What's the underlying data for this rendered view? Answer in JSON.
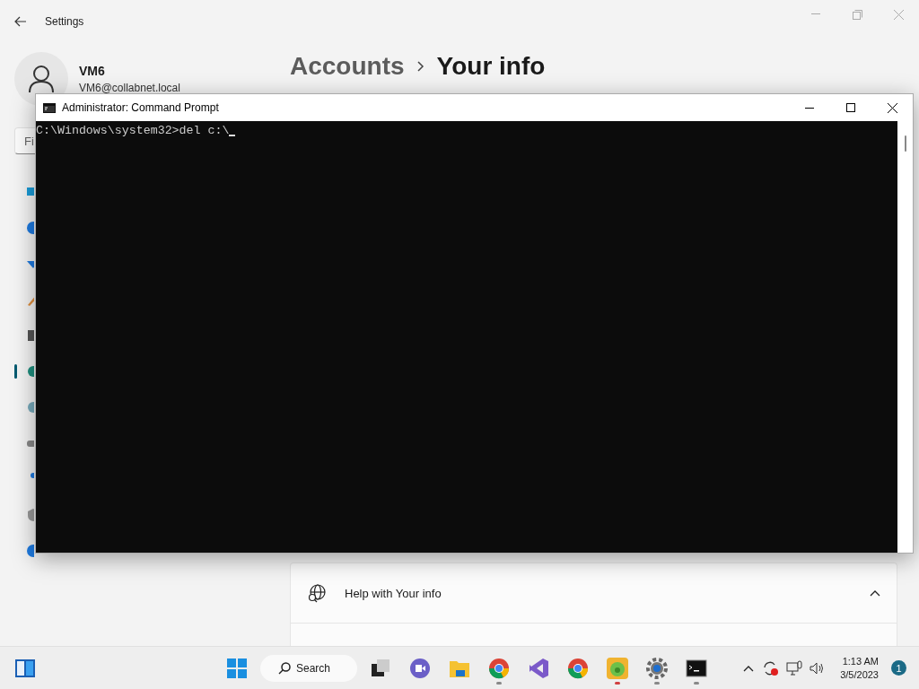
{
  "settings_window": {
    "title": "Settings",
    "profile": {
      "name": "VM6",
      "email": "VM6@collabnet.local"
    },
    "search": {
      "value": "Fi"
    },
    "sidebar": {
      "items": [
        {
          "selected": false
        },
        {
          "selected": false
        },
        {
          "selected": false
        },
        {
          "selected": false
        },
        {
          "selected": false
        },
        {
          "selected": true
        },
        {
          "selected": false
        },
        {
          "selected": false
        },
        {
          "selected": false
        },
        {
          "selected": false
        },
        {
          "selected": false
        }
      ]
    },
    "breadcrumb": [
      {
        "label": "Accounts",
        "current": false
      },
      {
        "label": "Your info",
        "current": true
      }
    ],
    "help_card": {
      "title": "Help with Your info",
      "expanded": true
    }
  },
  "cmd_window": {
    "title": "Administrator:  Command Prompt",
    "lines": [
      "C:\\Windows\\system32>del c:\\"
    ]
  },
  "taskbar": {
    "search": {
      "label": "Search"
    },
    "apps": [
      {
        "kind": "taskview",
        "running": false
      },
      {
        "kind": "meet",
        "running": false
      },
      {
        "kind": "folder",
        "running": false
      },
      {
        "kind": "chrome",
        "running": true
      },
      {
        "kind": "studio",
        "running": false
      },
      {
        "kind": "chrome",
        "running": false
      },
      {
        "kind": "game",
        "running": true
      },
      {
        "kind": "gear",
        "running": true
      },
      {
        "kind": "terminal",
        "running": true
      }
    ],
    "clock": {
      "time": "1:13 AM",
      "date": "3/5/2023"
    },
    "notifications": "1"
  }
}
